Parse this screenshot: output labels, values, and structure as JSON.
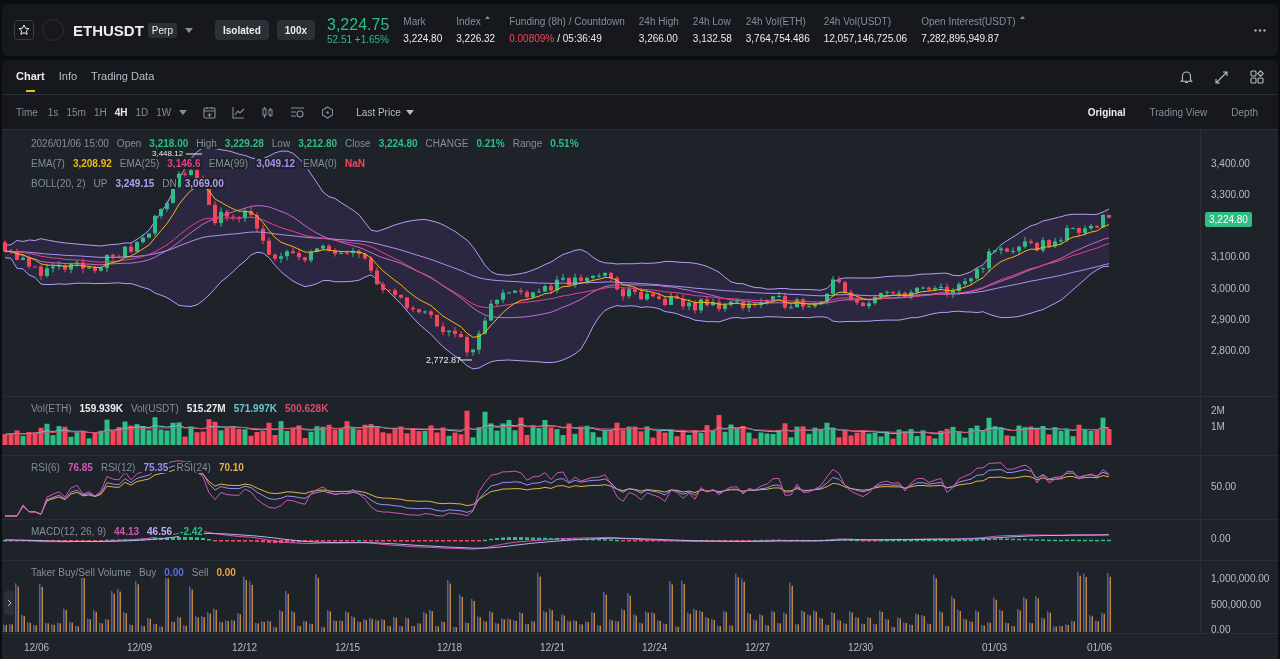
{
  "header": {
    "symbol": "ETHUSDT",
    "contract": "Perp",
    "margin_mode": "Isolated",
    "leverage": "100x",
    "last_price": "3,224.75",
    "change": "52.51 +1.65%",
    "stats": [
      {
        "label": "Mark",
        "value": "3,224.80",
        "info": false
      },
      {
        "label": "Index",
        "value": "3,226.32",
        "info": true
      },
      {
        "label": "Funding (8h) / Countdown",
        "rate": "0.00809%",
        "value": "/ 05:36:49",
        "info": false
      },
      {
        "label": "24h High",
        "value": "3,266.00",
        "info": false
      },
      {
        "label": "24h Low",
        "value": "3,132.58",
        "info": false
      },
      {
        "label": "24h Vol(ETH)",
        "value": "3,764,754.486",
        "info": false
      },
      {
        "label": "24h Vol(USDT)",
        "value": "12,057,146,725.06",
        "info": false
      },
      {
        "label": "Open Interest(USDT)",
        "value": "7,282,895,949.87",
        "info": true
      }
    ]
  },
  "tabs": [
    {
      "label": "Chart",
      "selected": true
    },
    {
      "label": "Info",
      "selected": false
    },
    {
      "label": "Trading Data",
      "selected": false
    }
  ],
  "toolbar": {
    "time_label": "Time",
    "intervals": [
      {
        "label": "1s",
        "selected": false
      },
      {
        "label": "15m",
        "selected": false
      },
      {
        "label": "1H",
        "selected": false
      },
      {
        "label": "4H",
        "selected": true
      },
      {
        "label": "1D",
        "selected": false
      },
      {
        "label": "1W",
        "selected": false
      }
    ],
    "price_type": "Last Price",
    "views": [
      {
        "label": "Original",
        "selected": true
      },
      {
        "label": "Trading View",
        "selected": false
      },
      {
        "label": "Depth",
        "selected": false
      }
    ]
  },
  "legend": {
    "date": "2026/01/06 15:00",
    "ohlc": [
      {
        "label": "Open",
        "value": "3,218.00",
        "color": "#2ebd85"
      },
      {
        "label": "High",
        "value": "3,229.28",
        "color": "#2ebd85"
      },
      {
        "label": "Low",
        "value": "3,212.80",
        "color": "#2ebd85"
      },
      {
        "label": "Close",
        "value": "3,224.80",
        "color": "#2ebd85"
      },
      {
        "label": "CHANGE",
        "value": "0.21%",
        "color": "#2ebd85"
      },
      {
        "label": "Range",
        "value": "0.51%",
        "color": "#2ebd85"
      }
    ],
    "ema": [
      {
        "label": "EMA(7)",
        "value": "3,208.92",
        "color": "#f0b90b"
      },
      {
        "label": "EMA(25)",
        "value": "3,146.6",
        "color": "#e0418a"
      },
      {
        "label": "EMA(99)",
        "value": "3,049.12",
        "color": "#a88ff0"
      },
      {
        "label": "EMA(0)",
        "value": "NaN",
        "color": "#f6465d"
      }
    ],
    "boll": {
      "label": "BOLL(20, 2)",
      "items": [
        {
          "label": "UP",
          "value": "3,249.15",
          "color": "#b59cf5"
        },
        {
          "label": "DN",
          "value": "3,069.00",
          "color": "#b59cf5"
        }
      ]
    }
  },
  "price_axis": [
    "3,400.00",
    "3,300.00",
    "3,100.00",
    "3,000.00",
    "2,900.00",
    "2,800.00"
  ],
  "price_tag": "3,224.80",
  "high_mark": "3,448.12",
  "low_mark": "2,772.87",
  "volume": {
    "items": [
      {
        "label": "Vol(ETH)",
        "value": "159.939K",
        "color": "#eaecef"
      },
      {
        "label": "Vol(USDT)",
        "value": "515.27M",
        "color": "#eaecef"
      },
      {
        "value": "571.997K",
        "color": "#6cc6d0"
      },
      {
        "value": "500.628K",
        "color": "#d0506e"
      }
    ],
    "axis": [
      "2M",
      "1M"
    ]
  },
  "rsi": {
    "items": [
      {
        "label": "RSI(6)",
        "value": "76.85",
        "color": "#d156b3"
      },
      {
        "label": "RSI(12)",
        "value": "75.35",
        "color": "#9b8ff0"
      },
      {
        "label": "RSI(24)",
        "value": "70.10",
        "color": "#e6b04a"
      }
    ],
    "axis": [
      "50.00"
    ]
  },
  "macd": {
    "items": [
      {
        "label": "MACD(12, 26, 9)",
        "value": "44.13",
        "color": "#d156b3"
      },
      {
        "value": "46.56",
        "color": "#b8b0f0"
      },
      {
        "value": "-2.42",
        "color": "#2ebd85"
      }
    ],
    "axis": [
      "0.00"
    ]
  },
  "taker": {
    "title": "Taker Buy/Sell Volume",
    "items": [
      {
        "label": "Buy",
        "value": "0.00",
        "color": "#5b6fe0"
      },
      {
        "label": "Sell",
        "value": "0.00",
        "color": "#e6a23c"
      }
    ],
    "axis": [
      "1,000,000.00",
      "500,000.00",
      "0.00"
    ]
  },
  "time_axis": [
    "12/06",
    "12/09",
    "12/12",
    "12/15",
    "12/18",
    "12/21",
    "12/24",
    "12/27",
    "12/30",
    "01/03",
    "01/06"
  ]
}
